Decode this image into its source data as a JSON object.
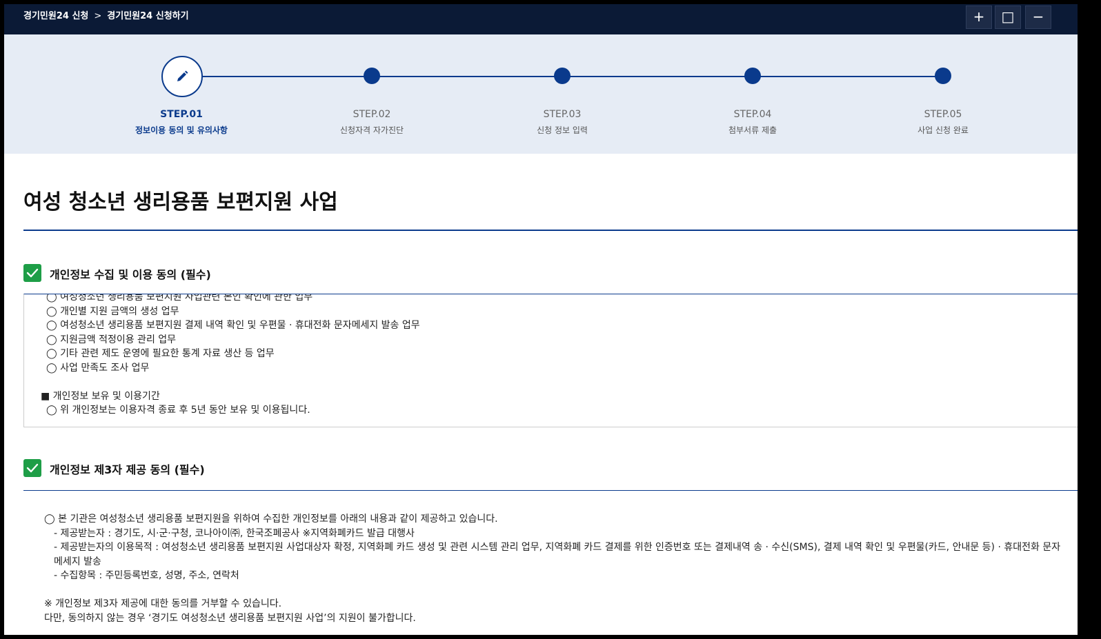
{
  "titlebar": {
    "breadcrumb_1": "경기민원24 신청",
    "breadcrumb_sep": ">",
    "breadcrumb_2": "경기민원24 신청하기",
    "btn_add": "+",
    "btn_maximize": "□",
    "btn_minimize": "−"
  },
  "steps": [
    {
      "num": "STEP.01",
      "label": "정보이용 동의 및 유의사항",
      "active": true
    },
    {
      "num": "STEP.02",
      "label": "신청자격 자가진단",
      "active": false
    },
    {
      "num": "STEP.03",
      "label": "신청 정보 입력",
      "active": false
    },
    {
      "num": "STEP.04",
      "label": "첨부서류 제출",
      "active": false
    },
    {
      "num": "STEP.05",
      "label": "사업 신청 완료",
      "active": false
    }
  ],
  "page_title": "여성 청소년 생리용품 보편지원 사업",
  "section1": {
    "title": "개인정보 수집 및 이용 동의 (필수)",
    "checked": true,
    "lines": [
      "◯ 여성청소년 생리용품 보편지원 사업관련 본인 확인에 관한 업무",
      "◯ 개인별 지원 금액의 생성 업무",
      "◯ 여성청소년 생리용품 보편지원 결제 내역 확인 및 우편물 · 휴대전화 문자메세지 발송 업무",
      "◯ 지원금액 적정이용 관리 업무",
      "◯ 기타 관련 제도 운영에 필요한 통계 자료 생산 등 업무",
      "◯ 사업 만족도 조사 업무",
      "■ 개인정보 보유 및 이용기간",
      "◯ 위 개인정보는 이용자격 종료 후 5년 동안 보유 및 이용됩니다."
    ]
  },
  "section2": {
    "title": "개인정보 제3자 제공 동의 (필수)",
    "checked": true,
    "lines": [
      "◯ 본 기관은 여성청소년 생리용품 보편지원을 위하여 수집한 개인정보를 아래의 내용과 같이 제공하고 있습니다.",
      "- 제공받는자 : 경기도, 시·군·구청, 코나아이㈜, 한국조폐공사 ※지역화폐카드 발급 대행사",
      "- 제공받는자의 이용목적 : 여성청소년 생리용품 보편지원 사업대상자 확정, 지역화폐 카드 생성 및 관련 시스템 관리 업무, 지역화폐 카드 결제를 위한 인증번호 또는 결제내역 송 · 수신(SMS),  결제 내역 확인 및 우편물(카드, 안내문 등) · 휴대전화 문자메세지 발송",
      "- 수집항목 : 주민등록번호, 성명, 주소, 연락처",
      "※ 개인정보 제3자 제공에 대한 동의를 거부할 수 있습니다.",
      "다만, 동의하지 않는 경우 ‘경기도 여성청소년 생리용품 보편지원 사업’의 지원이 불가합니다."
    ]
  }
}
